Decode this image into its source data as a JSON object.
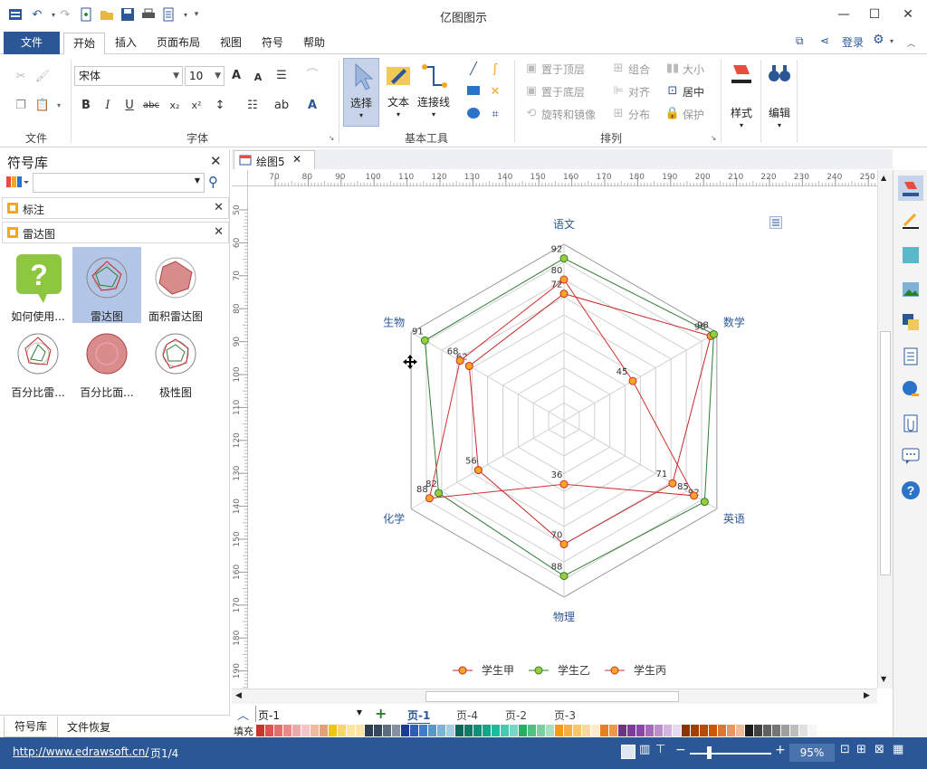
{
  "window": {
    "title": "亿图图示",
    "minimize": "—",
    "maximize": "☐",
    "close": "✕"
  },
  "menu": {
    "file": "文件",
    "tabs": [
      "开始",
      "插入",
      "页面布局",
      "视图",
      "符号",
      "帮助"
    ],
    "login": "登录"
  },
  "ribbon": {
    "groups": {
      "file": "文件",
      "font": "字体",
      "basic_tools": "基本工具",
      "arrange": "排列"
    },
    "font_name": "宋体",
    "font_size": "10",
    "tools": {
      "select": "选择",
      "text": "文本",
      "connector": "连接线"
    },
    "arrange_items": {
      "bring_front": "置于顶层",
      "send_back": "置于底层",
      "rotate": "旋转和镜像",
      "group": "组合",
      "align": "对齐",
      "distribute": "分布",
      "size": "大小",
      "center": "居中",
      "protect": "保护"
    },
    "style": "样式",
    "edit": "编辑"
  },
  "library": {
    "title": "符号库",
    "search_value": "",
    "categories": [
      "标注",
      "雷达图"
    ],
    "shapes": [
      {
        "label": "如何使用...",
        "icon": "help-question-icon"
      },
      {
        "label": "雷达图",
        "icon": "radar-chart-icon"
      },
      {
        "label": "面积雷达图",
        "icon": "area-radar-icon"
      },
      {
        "label": "百分比雷...",
        "icon": "percent-radar-icon"
      },
      {
        "label": "百分比面...",
        "icon": "percent-area-icon"
      },
      {
        "label": "极性图",
        "icon": "polar-chart-icon"
      }
    ],
    "bottom_tabs": [
      "符号库",
      "文件恢复"
    ]
  },
  "document": {
    "tab_title": "绘图5",
    "ruler_h": [
      "70",
      "80",
      "90",
      "100",
      "110",
      "120",
      "130",
      "140",
      "150",
      "160",
      "170",
      "180",
      "190",
      "200",
      "210",
      "220",
      "230",
      "240",
      "250"
    ],
    "ruler_v": [
      "50",
      "60",
      "70",
      "80",
      "90",
      "100",
      "110",
      "120",
      "130",
      "140",
      "150",
      "160",
      "170",
      "180",
      "190"
    ]
  },
  "chart_data": {
    "type": "radar",
    "axes": [
      "语文",
      "数学",
      "英语",
      "物理",
      "化学",
      "生物"
    ],
    "max": 100,
    "series": [
      {
        "name": "学生甲",
        "values": [
          72,
          96,
          71,
          70,
          56,
          62
        ],
        "color": "#c62828",
        "marker": "#f5a623"
      },
      {
        "name": "学生乙",
        "values": [
          92,
          98,
          92,
          88,
          82,
          91
        ],
        "color": "#2e7d32",
        "marker": "#9ccc3c"
      },
      {
        "name": "学生丙",
        "values": [
          80,
          45,
          85,
          36,
          88,
          68
        ],
        "color": "#d32f2f",
        "marker": "#f5a623"
      }
    ]
  },
  "pages": {
    "current": "页-1",
    "tabs": [
      "页-1",
      "页-4",
      "页-2",
      "页-3"
    ],
    "fill_label": "填充"
  },
  "status": {
    "url": "http://www.edrawsoft.cn/",
    "page_info": "页1/4",
    "zoom": "95%"
  },
  "colors": {
    "brand": "#2b5797",
    "palette": [
      "#c0392b",
      "#d9534f",
      "#e26d6d",
      "#e88a8a",
      "#f0a8a8",
      "#f7c5c5",
      "#f2b8a0",
      "#e5a07a",
      "#f1c40f",
      "#f5d76e",
      "#f9e79f",
      "#fce4a8",
      "#2c3e50",
      "#34495e",
      "#5d6d7e",
      "#85929e",
      "#1f3a93",
      "#2e5cb8",
      "#3d7ec9",
      "#5499c7",
      "#7fb3d5",
      "#a9cce3",
      "#0e6655",
      "#117a65",
      "#148f77",
      "#17a589",
      "#1abc9c",
      "#48c9b0",
      "#76d7c4",
      "#27ae60",
      "#52be80",
      "#7dcea0",
      "#a9dfbf",
      "#f39c12",
      "#f5b041",
      "#f8c471",
      "#fad7a0",
      "#fdebd0",
      "#e67e22",
      "#eb984e",
      "#6c3483",
      "#7d3c98",
      "#8e44ad",
      "#a569bd",
      "#bb8fce",
      "#d2b4de",
      "#e8daef",
      "#873600",
      "#a04000",
      "#ba4a00",
      "#d35400",
      "#dc7633",
      "#e59866",
      "#edbb99",
      "#1c1c1c",
      "#424242",
      "#616161",
      "#757575",
      "#9e9e9e",
      "#bdbdbd",
      "#e0e0e0",
      "#f5f5f5"
    ]
  }
}
